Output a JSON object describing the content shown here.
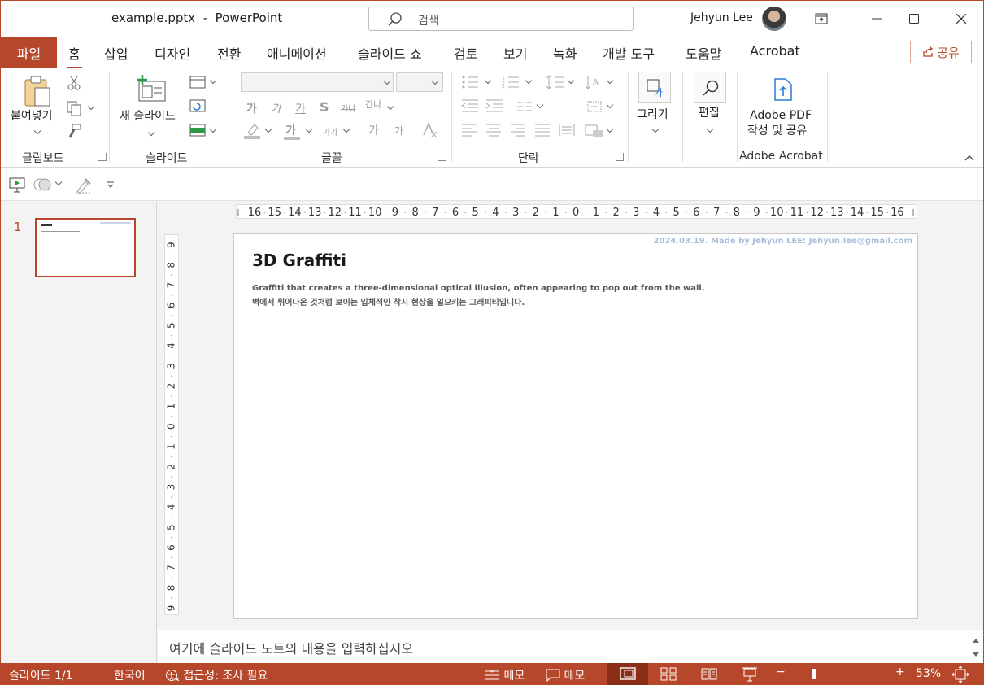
{
  "title_bar": {
    "file_name": "example.pptx",
    "separator": "-",
    "app_name": "PowerPoint",
    "search_placeholder": "검색",
    "user_name": "Jehyun Lee"
  },
  "tabs": {
    "file": "파일",
    "items": [
      "홈",
      "삽입",
      "디자인",
      "전환",
      "애니메이션",
      "슬라이드 쇼",
      "검토",
      "보기",
      "녹화",
      "개발 도구",
      "도움말",
      "Acrobat"
    ],
    "active": "홈",
    "share_label": "공유"
  },
  "ribbon": {
    "clipboard": {
      "paste_label": "붙여넣기",
      "group_label": "클립보드"
    },
    "slides": {
      "new_slide_label": "새 슬라이드",
      "group_label": "슬라이드"
    },
    "font": {
      "group_label": "글꼴",
      "bold": "가",
      "italic": "가",
      "underline": "가",
      "shadow": "S",
      "strike": "가나",
      "spacing": "간나",
      "color": "가",
      "case": "가가",
      "grow": "가",
      "shrink": "가"
    },
    "paragraph": {
      "group_label": "단락"
    },
    "drawing": {
      "label": "그리기"
    },
    "editing": {
      "label": "편집"
    },
    "acrobat": {
      "line1": "Adobe PDF",
      "line2": "작성 및 공유",
      "group_label": "Adobe Acrobat"
    }
  },
  "ruler": {
    "h_ticks": [
      "16",
      "15",
      "14",
      "13",
      "12",
      "11",
      "10",
      "9",
      "8",
      "7",
      "6",
      "5",
      "4",
      "3",
      "2",
      "1",
      "0",
      "1",
      "2",
      "3",
      "4",
      "5",
      "6",
      "7",
      "8",
      "9",
      "10",
      "11",
      "12",
      "13",
      "14",
      "15",
      "16"
    ],
    "v_ticks": [
      "9",
      "8",
      "7",
      "6",
      "5",
      "4",
      "3",
      "2",
      "1",
      "0",
      "1",
      "2",
      "3",
      "4",
      "5",
      "6",
      "7",
      "8",
      "9"
    ]
  },
  "thumbnails": {
    "slide_number": "1"
  },
  "slide": {
    "meta": "2024.03.19. Made by Jehyun LEE: Jehyun.lee@gmail.com",
    "title": "3D Graffiti",
    "line_en": "Graffiti that creates a three-dimensional optical illusion, often appearing to pop out from the wall.",
    "line_ko": "벽에서 튀어나온 것처럼 보이는 입체적인 착시 현상을 일으키는 그래피티입니다."
  },
  "notes": {
    "placeholder": "여기에 슬라이드 노트의 내용을 입력하십시오"
  },
  "status": {
    "slide_info": "슬라이드 1/1",
    "language": "한국어",
    "accessibility": "접근성: 조사 필요",
    "notes_label": "메모",
    "comments_label": "메모",
    "zoom_minus": "−",
    "zoom_plus": "+",
    "zoom": "53%"
  },
  "colors": {
    "accent": "#b7472a",
    "accent_dark": "#8c2e17",
    "meta_blue": "#a8bedb"
  }
}
